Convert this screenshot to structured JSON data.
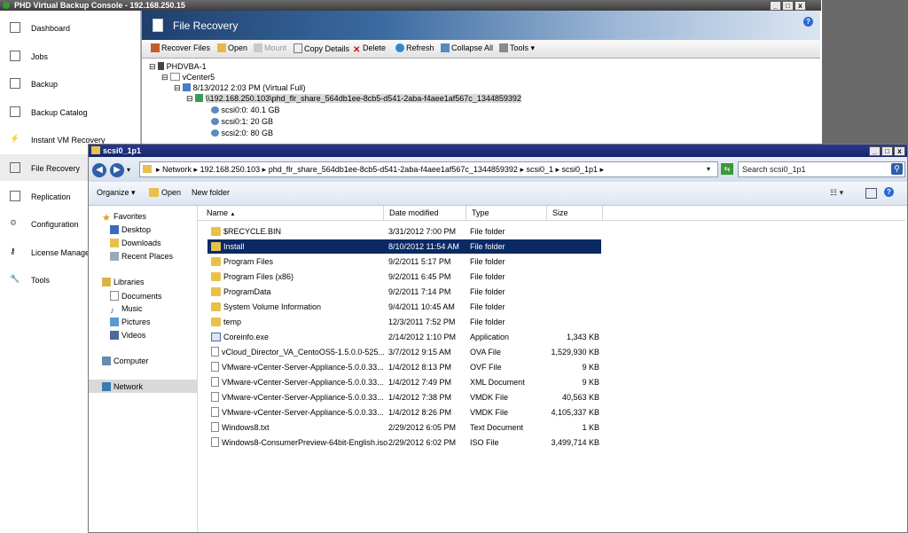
{
  "phd": {
    "title": "PHD Virtual Backup Console - 192.168.250.15",
    "sidebar": [
      {
        "label": "Dashboard",
        "icon": "dashboard-icon"
      },
      {
        "label": "Jobs",
        "icon": "jobs-icon"
      },
      {
        "label": "Backup",
        "icon": "backup-icon"
      },
      {
        "label": "Backup Catalog",
        "icon": "catalog-icon"
      },
      {
        "label": "Instant VM Recovery",
        "icon": "lightning-icon"
      },
      {
        "label": "File Recovery",
        "icon": "file-icon"
      },
      {
        "label": "Replication",
        "icon": "replication-icon"
      },
      {
        "label": "Configuration",
        "icon": "gear-icon"
      },
      {
        "label": "License Manager",
        "icon": "key-icon"
      },
      {
        "label": "Tools",
        "icon": "wrench-icon"
      }
    ],
    "header_title": "File Recovery",
    "toolbar": {
      "recover_files": "Recover Files",
      "open": "Open",
      "mount": "Mount",
      "copy_details": "Copy Details",
      "delete": "Delete",
      "refresh": "Refresh",
      "collapse_all": "Collapse All",
      "tools": "Tools"
    },
    "tree": {
      "root": "PHDVBA-1",
      "vcenter": "vCenter5",
      "backup": "8/13/2012 2:03 PM (Virtual Full)",
      "share": "\\\\192.168.250.103\\phd_flr_share_564db1ee-8cb5-d541-2aba-f4aee1af567c_1344859392",
      "disks": [
        "scsi0:0: 40.1 GB",
        "scsi0:1: 20 GB",
        "scsi2:0: 80 GB"
      ]
    }
  },
  "explorer": {
    "title": "scsi0_1p1",
    "breadcrumb": [
      "Network",
      "192.168.250.103",
      "phd_flr_share_564db1ee-8cb5-d541-2aba-f4aee1af567c_1344859392",
      "scsi0_1",
      "scsi0_1p1"
    ],
    "search_placeholder": "Search scsi0_1p1",
    "commands": {
      "organize": "Organize",
      "open": "Open",
      "new_folder": "New folder"
    },
    "nav": {
      "favorites": "Favorites",
      "desktop": "Desktop",
      "downloads": "Downloads",
      "recent_places": "Recent Places",
      "libraries": "Libraries",
      "documents": "Documents",
      "music": "Music",
      "pictures": "Pictures",
      "videos": "Videos",
      "computer": "Computer",
      "network": "Network"
    },
    "columns": {
      "name": "Name",
      "date_modified": "Date modified",
      "type": "Type",
      "size": "Size"
    },
    "files": [
      {
        "name": "$RECYCLE.BIN",
        "date": "3/31/2012 7:00 PM",
        "type": "File folder",
        "size": "",
        "icon": "folder-icon"
      },
      {
        "name": "Install",
        "date": "8/10/2012 11:54 AM",
        "type": "File folder",
        "size": "",
        "icon": "folder-icon",
        "selected": true
      },
      {
        "name": "Program Files",
        "date": "9/2/2011 5:17 PM",
        "type": "File folder",
        "size": "",
        "icon": "folder-icon"
      },
      {
        "name": "Program Files (x86)",
        "date": "9/2/2011 6:45 PM",
        "type": "File folder",
        "size": "",
        "icon": "folder-icon"
      },
      {
        "name": "ProgramData",
        "date": "9/2/2011 7:14 PM",
        "type": "File folder",
        "size": "",
        "icon": "folder-icon"
      },
      {
        "name": "System Volume Information",
        "date": "9/4/2011 10:45 AM",
        "type": "File folder",
        "size": "",
        "icon": "folder-icon"
      },
      {
        "name": "temp",
        "date": "12/3/2011 7:52 PM",
        "type": "File folder",
        "size": "",
        "icon": "folder-icon"
      },
      {
        "name": "Coreinfo.exe",
        "date": "2/14/2012 1:10 PM",
        "type": "Application",
        "size": "1,343 KB",
        "icon": "application-icon"
      },
      {
        "name": "vCloud_Director_VA_CentoOS5-1.5.0.0-525...",
        "date": "3/7/2012 9:15 AM",
        "type": "OVA File",
        "size": "1,529,930 KB",
        "icon": "document-icon"
      },
      {
        "name": "VMware-vCenter-Server-Appliance-5.0.0.33...",
        "date": "1/4/2012 8:13 PM",
        "type": "OVF File",
        "size": "9 KB",
        "icon": "document-icon"
      },
      {
        "name": "VMware-vCenter-Server-Appliance-5.0.0.33...",
        "date": "1/4/2012 7:49 PM",
        "type": "XML Document",
        "size": "9 KB",
        "icon": "document-icon"
      },
      {
        "name": "VMware-vCenter-Server-Appliance-5.0.0.33...",
        "date": "1/4/2012 7:38 PM",
        "type": "VMDK File",
        "size": "40,563 KB",
        "icon": "document-icon"
      },
      {
        "name": "VMware-vCenter-Server-Appliance-5.0.0.33...",
        "date": "1/4/2012 8:26 PM",
        "type": "VMDK File",
        "size": "4,105,337 KB",
        "icon": "document-icon"
      },
      {
        "name": "Windows8.txt",
        "date": "2/29/2012 6:05 PM",
        "type": "Text Document",
        "size": "1 KB",
        "icon": "document-icon"
      },
      {
        "name": "Windows8-ConsumerPreview-64bit-English.iso",
        "date": "2/29/2012 6:02 PM",
        "type": "ISO File",
        "size": "3,499,714 KB",
        "icon": "document-icon"
      }
    ]
  }
}
